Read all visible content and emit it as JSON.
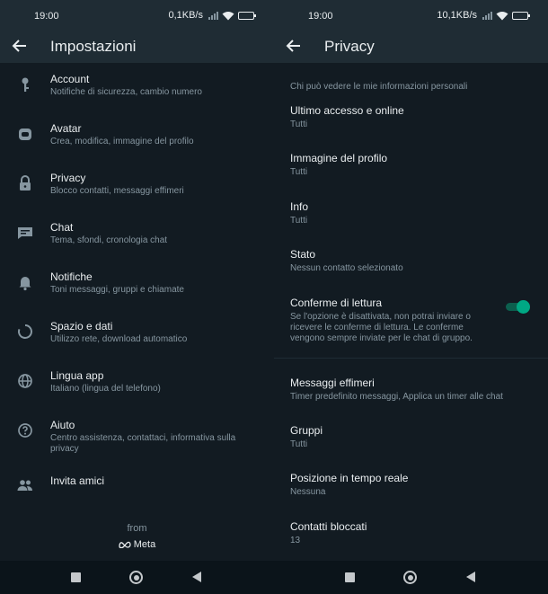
{
  "colors": {
    "background": "#121b22",
    "bar": "#1f2c34",
    "accent": "#00a884",
    "secondary_text": "#8696a0"
  },
  "left": {
    "status": {
      "time": "19:00",
      "speed": "0,1KB/s"
    },
    "title": "Impostazioni",
    "items": [
      {
        "icon": "key-icon",
        "label": "Account",
        "sub": "Notifiche di sicurezza, cambio numero"
      },
      {
        "icon": "avatar-icon",
        "label": "Avatar",
        "sub": "Crea, modifica, immagine del profilo"
      },
      {
        "icon": "lock-icon",
        "label": "Privacy",
        "sub": "Blocco contatti, messaggi effimeri"
      },
      {
        "icon": "chat-icon",
        "label": "Chat",
        "sub": "Tema, sfondi, cronologia chat"
      },
      {
        "icon": "bell-icon",
        "label": "Notifiche",
        "sub": "Toni messaggi, gruppi e chiamate"
      },
      {
        "icon": "storage-icon",
        "label": "Spazio e dati",
        "sub": "Utilizzo rete, download automatico"
      },
      {
        "icon": "globe-icon",
        "label": "Lingua app",
        "sub": "Italiano (lingua del telefono)"
      },
      {
        "icon": "help-icon",
        "label": "Aiuto",
        "sub": "Centro assistenza, contattaci, informativa sulla privacy"
      },
      {
        "icon": "people-icon",
        "label": "Invita amici",
        "sub": ""
      }
    ],
    "from_label": "from",
    "meta_label": "Meta"
  },
  "right": {
    "status": {
      "time": "19:00",
      "speed": "10,1KB/s"
    },
    "title": "Privacy",
    "section_head": "Chi può vedere le mie informazioni personali",
    "items": [
      {
        "label": "Ultimo accesso e online",
        "sub": "Tutti"
      },
      {
        "label": "Immagine del profilo",
        "sub": "Tutti"
      },
      {
        "label": "Info",
        "sub": "Tutti"
      },
      {
        "label": "Stato",
        "sub": "Nessun contatto selezionato"
      },
      {
        "label": "Conferme di lettura",
        "sub": "Se l'opzione è disattivata, non potrai inviare o ricevere le conferme di lettura. Le conferme vengono sempre inviate per le chat di gruppo."
      },
      {
        "label": "Messaggi effimeri",
        "sub": "Timer predefinito messaggi, Applica un timer alle chat"
      },
      {
        "label": "Gruppi",
        "sub": "Tutti"
      },
      {
        "label": "Posizione in tempo reale",
        "sub": "Nessuna"
      },
      {
        "label": "Contatti bloccati",
        "sub": "13"
      }
    ],
    "read_receipts_enabled": true
  }
}
